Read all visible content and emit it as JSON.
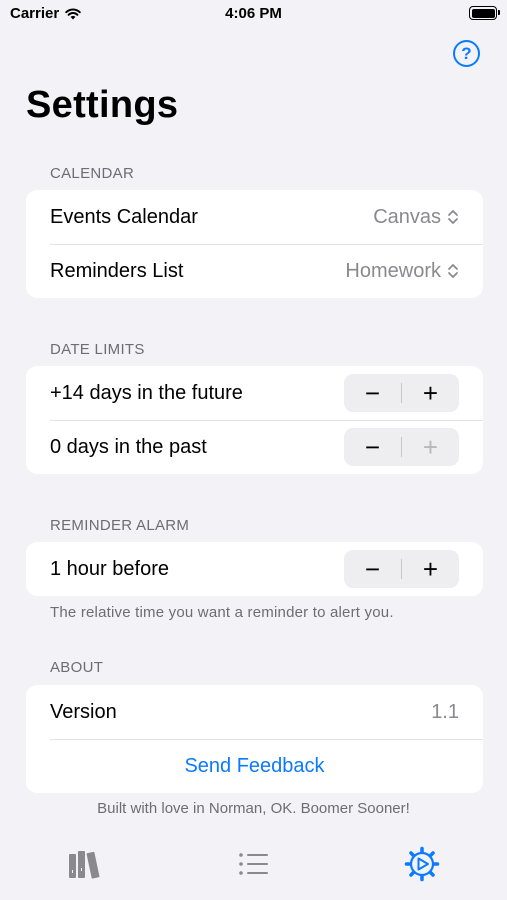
{
  "status_bar": {
    "carrier": "Carrier",
    "time": "4:06 PM"
  },
  "header": {
    "help_icon": "question-circle-icon",
    "help_glyph": "?",
    "title": "Settings"
  },
  "calendar_section": {
    "header": "CALENDAR",
    "rows": [
      {
        "label": "Events Calendar",
        "value": "Canvas"
      },
      {
        "label": "Reminders List",
        "value": "Homework"
      }
    ]
  },
  "date_limits_section": {
    "header": "DATE LIMITS",
    "rows": [
      {
        "label": "+14 days in the future",
        "minus_enabled": true,
        "plus_enabled": true
      },
      {
        "label": "0 days in the past",
        "minus_enabled": true,
        "plus_enabled": false
      }
    ],
    "minus_glyph": "−",
    "plus_glyph": "+"
  },
  "reminder_alarm_section": {
    "header": "REMINDER ALARM",
    "row_label": "1 hour before",
    "footer": "The relative time you want a reminder to alert you."
  },
  "about_section": {
    "header": "ABOUT",
    "version_label": "Version",
    "version_value": "1.1",
    "feedback_label": "Send Feedback"
  },
  "built_note": "Built with love in Norman, OK. Boomer Sooner!",
  "tab_bar": {
    "tabs": [
      {
        "icon": "books-icon",
        "selected": false
      },
      {
        "icon": "list-icon",
        "selected": false
      },
      {
        "icon": "gear-play-icon",
        "selected": true
      }
    ]
  },
  "colors": {
    "accent": "#0a7aff",
    "background": "#f2f2f7",
    "secondary_text": "#8a8a8e",
    "tab_inactive": "#8a8a8e"
  }
}
